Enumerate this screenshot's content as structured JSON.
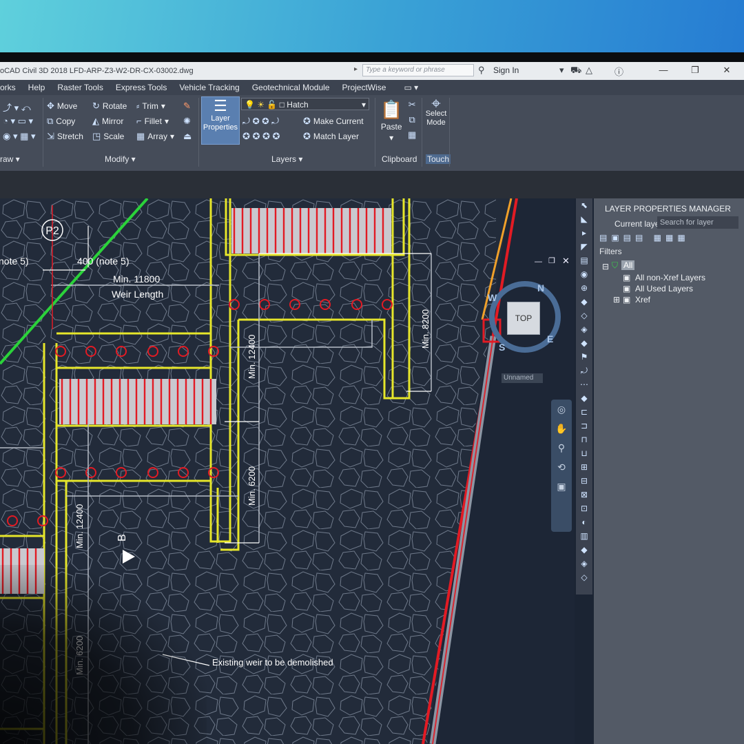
{
  "titlebar": {
    "title": "oCAD Civil 3D 2018   LFD-ARP-Z3-W2-DR-CX-03002.dwg",
    "search_placeholder": "Type a keyword or phrase",
    "sign_in": "Sign In"
  },
  "menu": [
    "orks",
    "Help",
    "Raster Tools",
    "Express Tools",
    "Vehicle Tracking",
    "Geotechnical Module",
    "ProjectWise"
  ],
  "ribbon": {
    "modify": {
      "move": "Move",
      "rotate": "Rotate",
      "trim": "Trim",
      "copy": "Copy",
      "mirror": "Mirror",
      "fillet": "Fillet",
      "stretch": "Stretch",
      "scale": "Scale",
      "array": "Array",
      "label": "Modify ▾"
    },
    "draw_label": "raw ▾",
    "layers": {
      "layer_properties": "Layer Properties",
      "hatch": "Hatch",
      "make_current": "Make Current",
      "match_layer": "Match Layer",
      "label": "Layers ▾"
    },
    "clipboard": {
      "paste": "Paste",
      "label": "Clipboard"
    },
    "touch": {
      "select_mode": "Select Mode",
      "label": "Touch"
    }
  },
  "drawing": {
    "labels": {
      "p2": "P2",
      "note5_left": "note 5)",
      "note5_mid": "400 (note 5)",
      "min11800": "Min. 11800",
      "weir_length": "Weir Length",
      "min12400_a": "Min. 12400",
      "min8200": "Min. 8200",
      "min6200_a": "Min. 6200",
      "min12400_b": "Min. 12400",
      "min6200_b": "Min. 6200",
      "section_b": "B",
      "existing_weir": "Existing weir to be demolished"
    },
    "viewcube": {
      "top": "TOP",
      "n": "N",
      "w": "W",
      "s": "S",
      "e": "E",
      "unnamed": "Unnamed"
    }
  },
  "layer_panel": {
    "title": "LAYER PROPERTIES MANAGER",
    "current_layer": "Current layer",
    "search_placeholder": "Search for layer",
    "filters": "Filters",
    "tree": [
      "All",
      "All non-Xref Layers",
      "All Used Layers",
      "Xref"
    ]
  }
}
